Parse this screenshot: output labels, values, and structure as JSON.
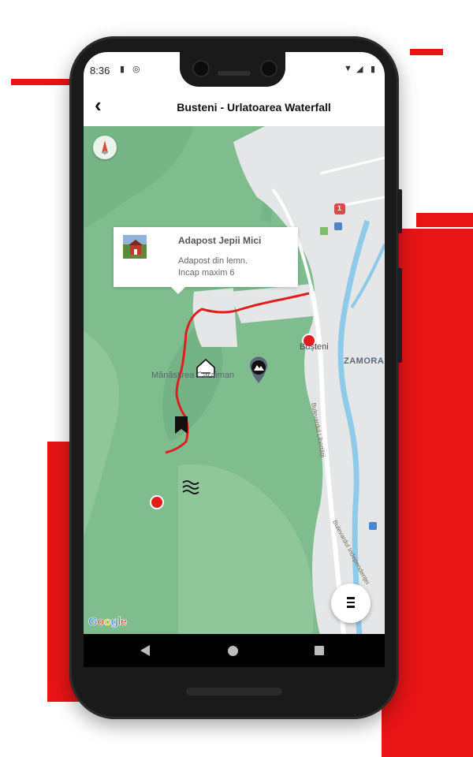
{
  "status_bar": {
    "time": "8:36"
  },
  "header": {
    "title": "Busteni - Urlatoarea Waterfall",
    "back_icon": "chevron-left-icon"
  },
  "popup": {
    "title": "Adapost Jepii Mici",
    "description_line1": "Adapost din lemn.",
    "description_line2": "Incap maxim 6"
  },
  "map": {
    "labels": {
      "town": "Bușteni",
      "monastery": "Mănăstirea Caraiman",
      "district": "ZAMORA",
      "street_1": "Bulevardul Libertății",
      "street_2": "Bulevardul Independenței",
      "road_badge": "1"
    },
    "google_logo": [
      "G",
      "o",
      "o",
      "g",
      "l",
      "e"
    ],
    "colors": {
      "terrain": "#7fbd8f",
      "route": "#e01e1e",
      "urban": "#e4e6e8",
      "river": "#8ecbe8"
    }
  },
  "fab": {
    "icon": "menu-icon"
  },
  "nav": {
    "back": "back-icon",
    "home": "home-icon",
    "recents": "recents-icon"
  }
}
